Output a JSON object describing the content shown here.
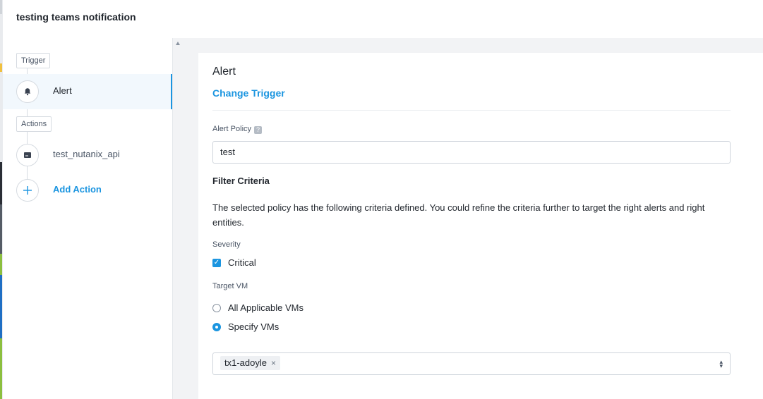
{
  "header": {
    "title": "testing teams notification"
  },
  "sidebar": {
    "trigger_tag": "Trigger",
    "trigger_step": {
      "label": "Alert",
      "icon": "bell-icon"
    },
    "actions_tag": "Actions",
    "action_step": {
      "label": "test_nutanix_api",
      "icon": "terminal-icon"
    },
    "add_action": {
      "label": "Add Action",
      "icon": "plus-icon"
    }
  },
  "main": {
    "heading": "Alert",
    "change_trigger": "Change Trigger",
    "alert_policy": {
      "label": "Alert Policy",
      "help": "?",
      "value": "test"
    },
    "filter_title": "Filter Criteria",
    "filter_desc": "The selected policy has the following criteria defined. You could refine the criteria further to target the right alerts and right entities.",
    "severity": {
      "label": "Severity",
      "option": "Critical",
      "checked": true
    },
    "target_vm": {
      "label": "Target VM",
      "options": [
        "All Applicable VMs",
        "Specify VMs"
      ],
      "selected": "Specify VMs"
    },
    "vm_select": {
      "chips": [
        "tx1-adoyle"
      ],
      "remove_glyph": "×"
    }
  },
  "colors": {
    "accent": "#1b95e0",
    "panel_bg": "#f2f3f5"
  }
}
